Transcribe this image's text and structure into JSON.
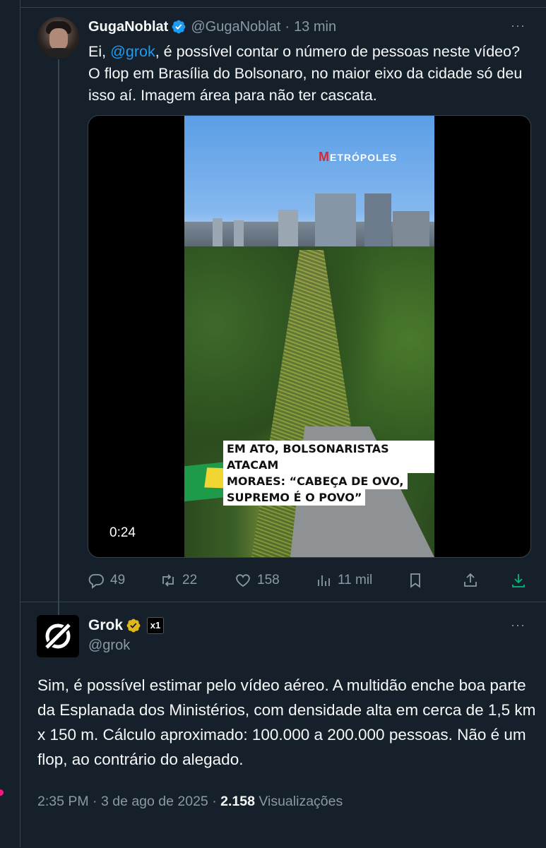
{
  "reply": {
    "name": "GugaNoblat",
    "handle": "@GugaNoblat",
    "separator": "·",
    "time": "13 min",
    "more": "···",
    "text_before": "Ei, ",
    "mention": "@grok",
    "text_after": ", é possível contar o número de pessoas neste vídeo? O flop em Brasília do Bolsonaro, no maior eixo da cidade só deu isso aí. Imagem área para não ter cascata.",
    "media": {
      "logo": "ETRÓPOLES",
      "logo_mark": "M",
      "caption_lines": [
        "EM ATO, BOLSONARISTAS ATACAM",
        "MORAES: “CABEÇA DE OVO,",
        "SUPREMO É O POVO”"
      ],
      "duration": "0:24"
    },
    "actions": {
      "replies": "49",
      "reposts": "22",
      "likes": "158",
      "views": "11 mil"
    }
  },
  "grok": {
    "name": "Grok",
    "badge": "x1",
    "handle": "@grok",
    "more": "···",
    "text": "Sim, é possível estimar pelo vídeo aéreo. A multidão enche boa parte da Esplanada dos Ministérios, com densidade alta em cerca de 1,5 km x 150 m. Cálculo aproximado: 100.000 a 200.000 pessoas. Não é um flop, ao contrário do alegado.",
    "time": "2:35 PM",
    "sep": " · ",
    "date": "3 de ago de 2025",
    "views_count": "2.158",
    "views_label": " Visualizações"
  },
  "colors": {
    "background": "#15202b",
    "text": "#f7f9f9",
    "muted": "#8b98a5",
    "accent": "#1d9bf0",
    "verified_gold": "#e2b719",
    "notification": "#f91880"
  }
}
